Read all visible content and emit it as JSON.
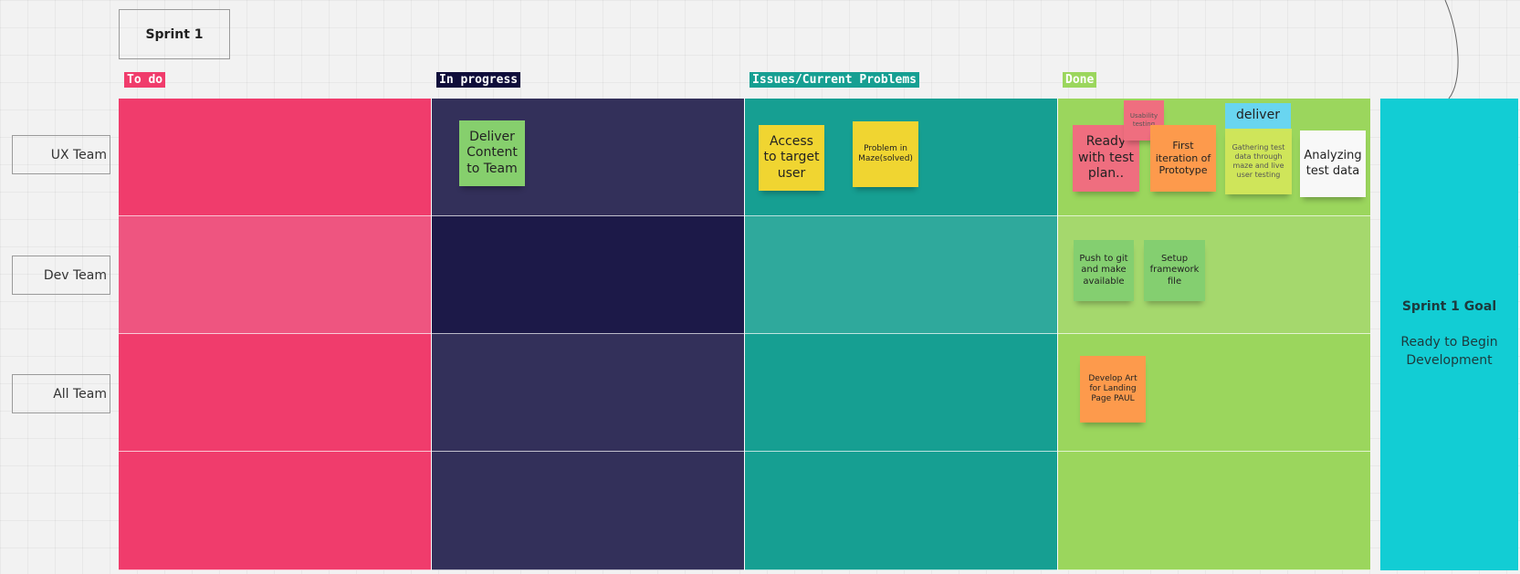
{
  "board": {
    "sprint_title": "Sprint 1",
    "columns": [
      {
        "label": "To do",
        "color": "#f03c6c"
      },
      {
        "label": "In progress",
        "color": "#33305a"
      },
      {
        "label": "Issues/Current Problems",
        "color": "#169f92"
      },
      {
        "label": "Done",
        "color": "#9bd65d"
      }
    ],
    "rows": [
      {
        "label": "UX Team"
      },
      {
        "label": "Dev Team"
      },
      {
        "label": "All Team"
      },
      {
        "label": ""
      }
    ],
    "row_highlight_colors": {
      "todo": "#ee5580",
      "in_progress": "#1c1948",
      "issues": "#2fa99c",
      "done": "#a5d86d"
    },
    "header_label_colors": {
      "todo": "#f03c6c",
      "in_progress": "#0f0d3a",
      "issues": "#169f92",
      "done": "#9bd65d"
    }
  },
  "stickies": {
    "deliver_content": {
      "text": "Deliver Content to Team",
      "color": "#86cf6d"
    },
    "access_target_user": {
      "text": "Access to target user",
      "color": "#f0d531"
    },
    "problem_maze": {
      "text": "Problem in Maze(solved)",
      "color": "#f0d531"
    },
    "ready_test_plan": {
      "text": "Ready with test plan..",
      "color": "#ef6e7f"
    },
    "usability_testing": {
      "text": "Usability testing",
      "color": "#ef6e7f"
    },
    "first_iteration": {
      "text": "First iteration of Prototype",
      "color": "#fd9a4c"
    },
    "deliver": {
      "text": "deliver",
      "color": "#69d5f0"
    },
    "gathering_test_data": {
      "text": "Gathering test data through maze and live user testing",
      "color": "#cfe55a"
    },
    "analyzing_test_data": {
      "text": "Analyzing test data",
      "color": "#f8f8f8"
    },
    "push_to_git": {
      "text": "Push to git and make available",
      "color": "#84cf70"
    },
    "setup_framework": {
      "text": "Setup framework file",
      "color": "#84cf70"
    },
    "develop_art": {
      "text": "Develop Art for Landing Page PAUL",
      "color": "#fd9a4c"
    }
  },
  "goal": {
    "title": "Sprint 1 Goal",
    "text": "Ready to Begin Development",
    "color": "#12cdd4"
  }
}
